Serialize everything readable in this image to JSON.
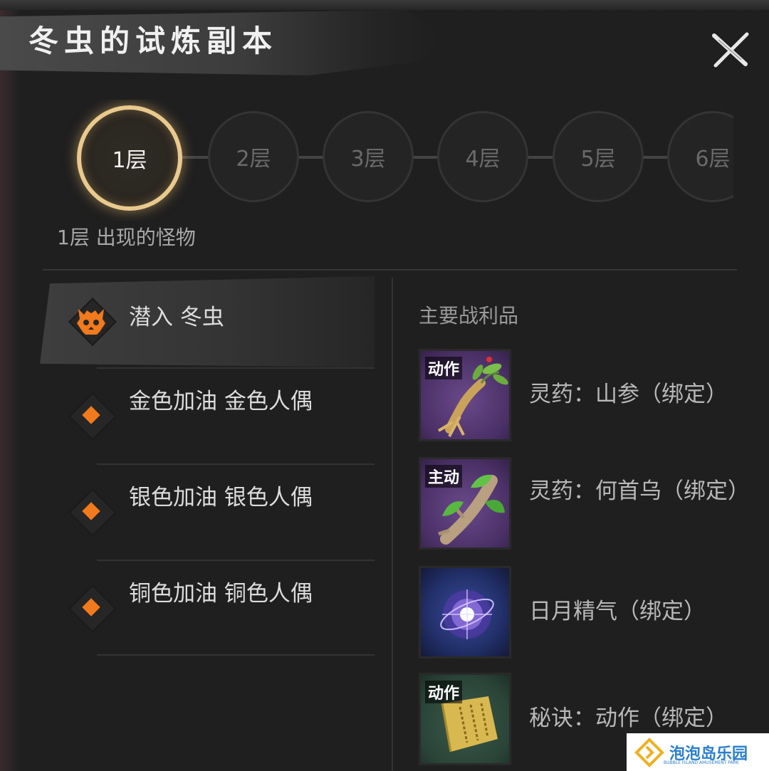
{
  "header": {
    "title": "冬虫的试炼副本"
  },
  "floors": [
    "1层",
    "2层",
    "3层",
    "4层",
    "5层",
    "6层"
  ],
  "active_floor_index": 0,
  "monsters_section": {
    "title": "1层 出现的怪物",
    "items": [
      {
        "name": "潜入 冬虫",
        "icon": "demon-skull-icon",
        "selected": true
      },
      {
        "name": "金色加油 金色人偶",
        "icon": "orange-diamond-icon",
        "selected": false
      },
      {
        "name": "银色加油 银色人偶",
        "icon": "orange-diamond-icon",
        "selected": false
      },
      {
        "name": "铜色加油 铜色人偶",
        "icon": "orange-diamond-icon",
        "selected": false
      }
    ]
  },
  "loot_section": {
    "title": "主要战利品",
    "items": [
      {
        "badge": "动作",
        "name": "灵药：山参（绑定）",
        "icon": "ginseng-icon"
      },
      {
        "badge": "主动",
        "name": "灵药：何首乌（绑定）",
        "icon": "fleeceflower-root-icon"
      },
      {
        "badge": "",
        "name": "日月精气（绑定）",
        "icon": "energy-orb-icon"
      },
      {
        "badge": "动作",
        "name": "秘诀：动作（绑定）",
        "icon": "scroll-icon"
      }
    ]
  },
  "watermark": {
    "text": "泡泡岛乐园",
    "subtext": "BUBBLE ISLAND AMUSEMENT PARK"
  },
  "colors": {
    "accent_gold": "#e9c98e",
    "marker_orange": "#f07a1c",
    "panel_bg": "#1f1f1f"
  }
}
